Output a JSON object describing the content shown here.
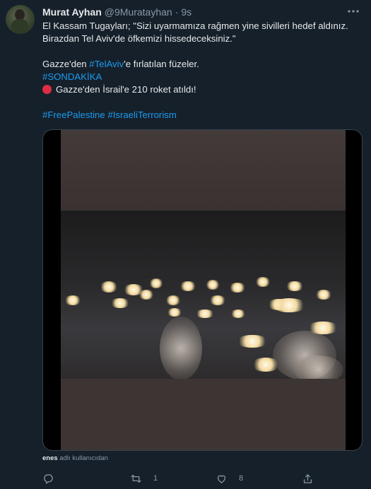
{
  "tweet": {
    "author": {
      "name": "Murat Ayhan",
      "handle": "@9Muratayhan",
      "separator": "·",
      "time": "9s"
    },
    "lines": {
      "l1": "El Kassam Tugayları; \"Sizi uyarmamıza rağmen yine sivilleri hedef aldınız.",
      "l2": "Birazdan Tel Aviv'de öfkemizi hissedeceksiniz.\"",
      "l3_pre": "Gazze'den ",
      "l3_tag": "#TelAviv",
      "l3_post": "'e fırlatılan füzeler.",
      "l4_tag": "#SONDAKİKA",
      "l5": "Gazze'den İsrail'e 210 roket atıldı!",
      "l6_tag1": "#FreePalestine",
      "l6_tag2": "#IsraeliTerrorism"
    },
    "media_attribution": {
      "user": "enes",
      "text": " adlı kullanıcıdan"
    },
    "actions": {
      "reply_count": "",
      "retweet_count": "1",
      "like_count": "8"
    }
  },
  "colors": {
    "background": "#15202b",
    "link": "#1d9bf0",
    "muted": "#8b98a5",
    "emoji_red": "#dd2e44"
  },
  "icons": {
    "reply": "reply-icon",
    "retweet": "retweet-icon",
    "like": "like-icon",
    "share": "share-icon",
    "more": "more-icon"
  }
}
